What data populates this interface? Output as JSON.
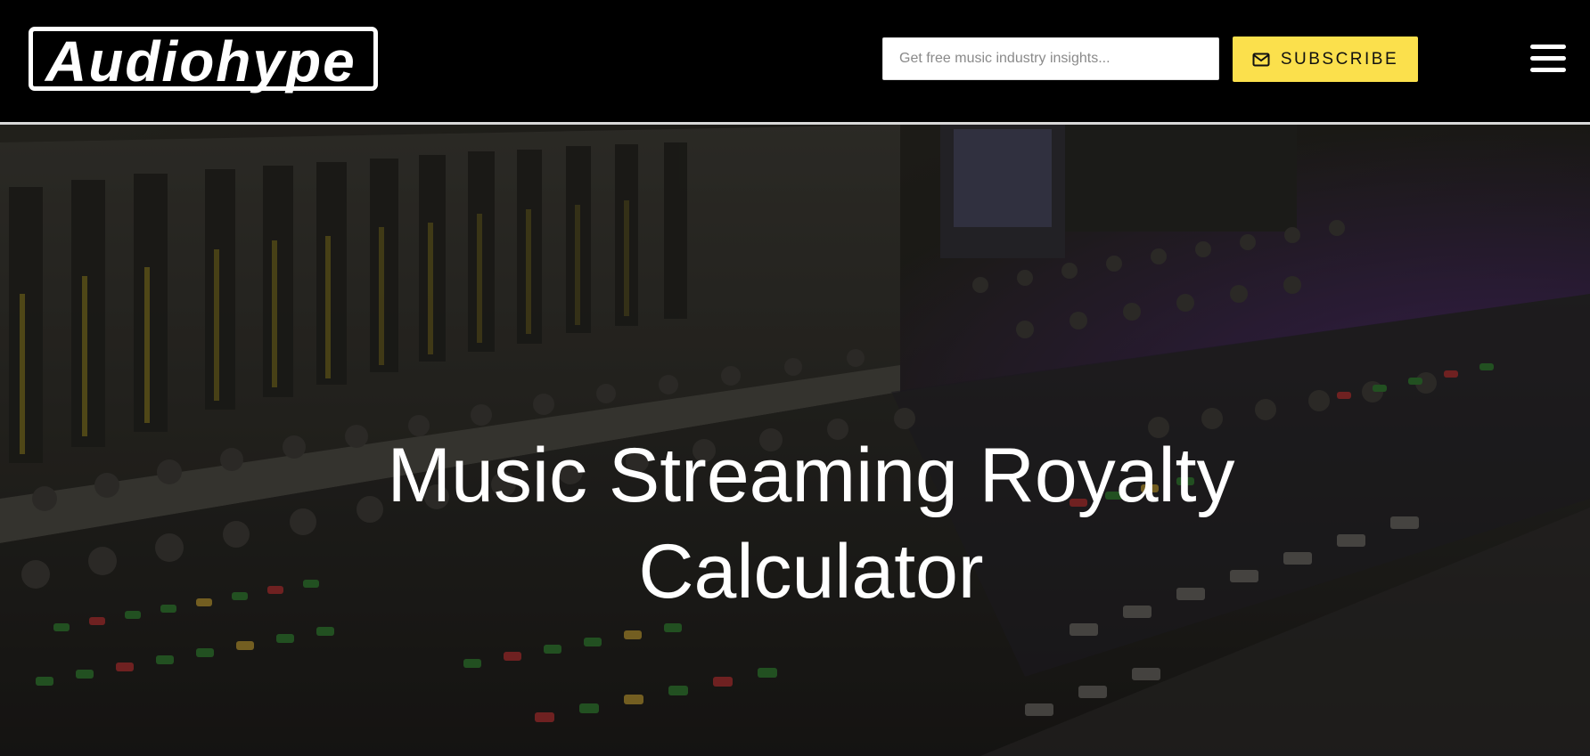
{
  "header": {
    "logo_text": "Audiohype",
    "search": {
      "placeholder": "Get free music industry insights...",
      "value": ""
    },
    "subscribe_label": "SUBSCRIBE",
    "icons": {
      "subscribe": "envelope-icon",
      "menu": "hamburger-menu-icon"
    }
  },
  "hero": {
    "title": "Music Streaming Royalty Calculator",
    "background": "mixing-console-photo"
  },
  "colors": {
    "header_bg": "#000000",
    "accent": "#fbe04c",
    "title": "#ffffff"
  }
}
